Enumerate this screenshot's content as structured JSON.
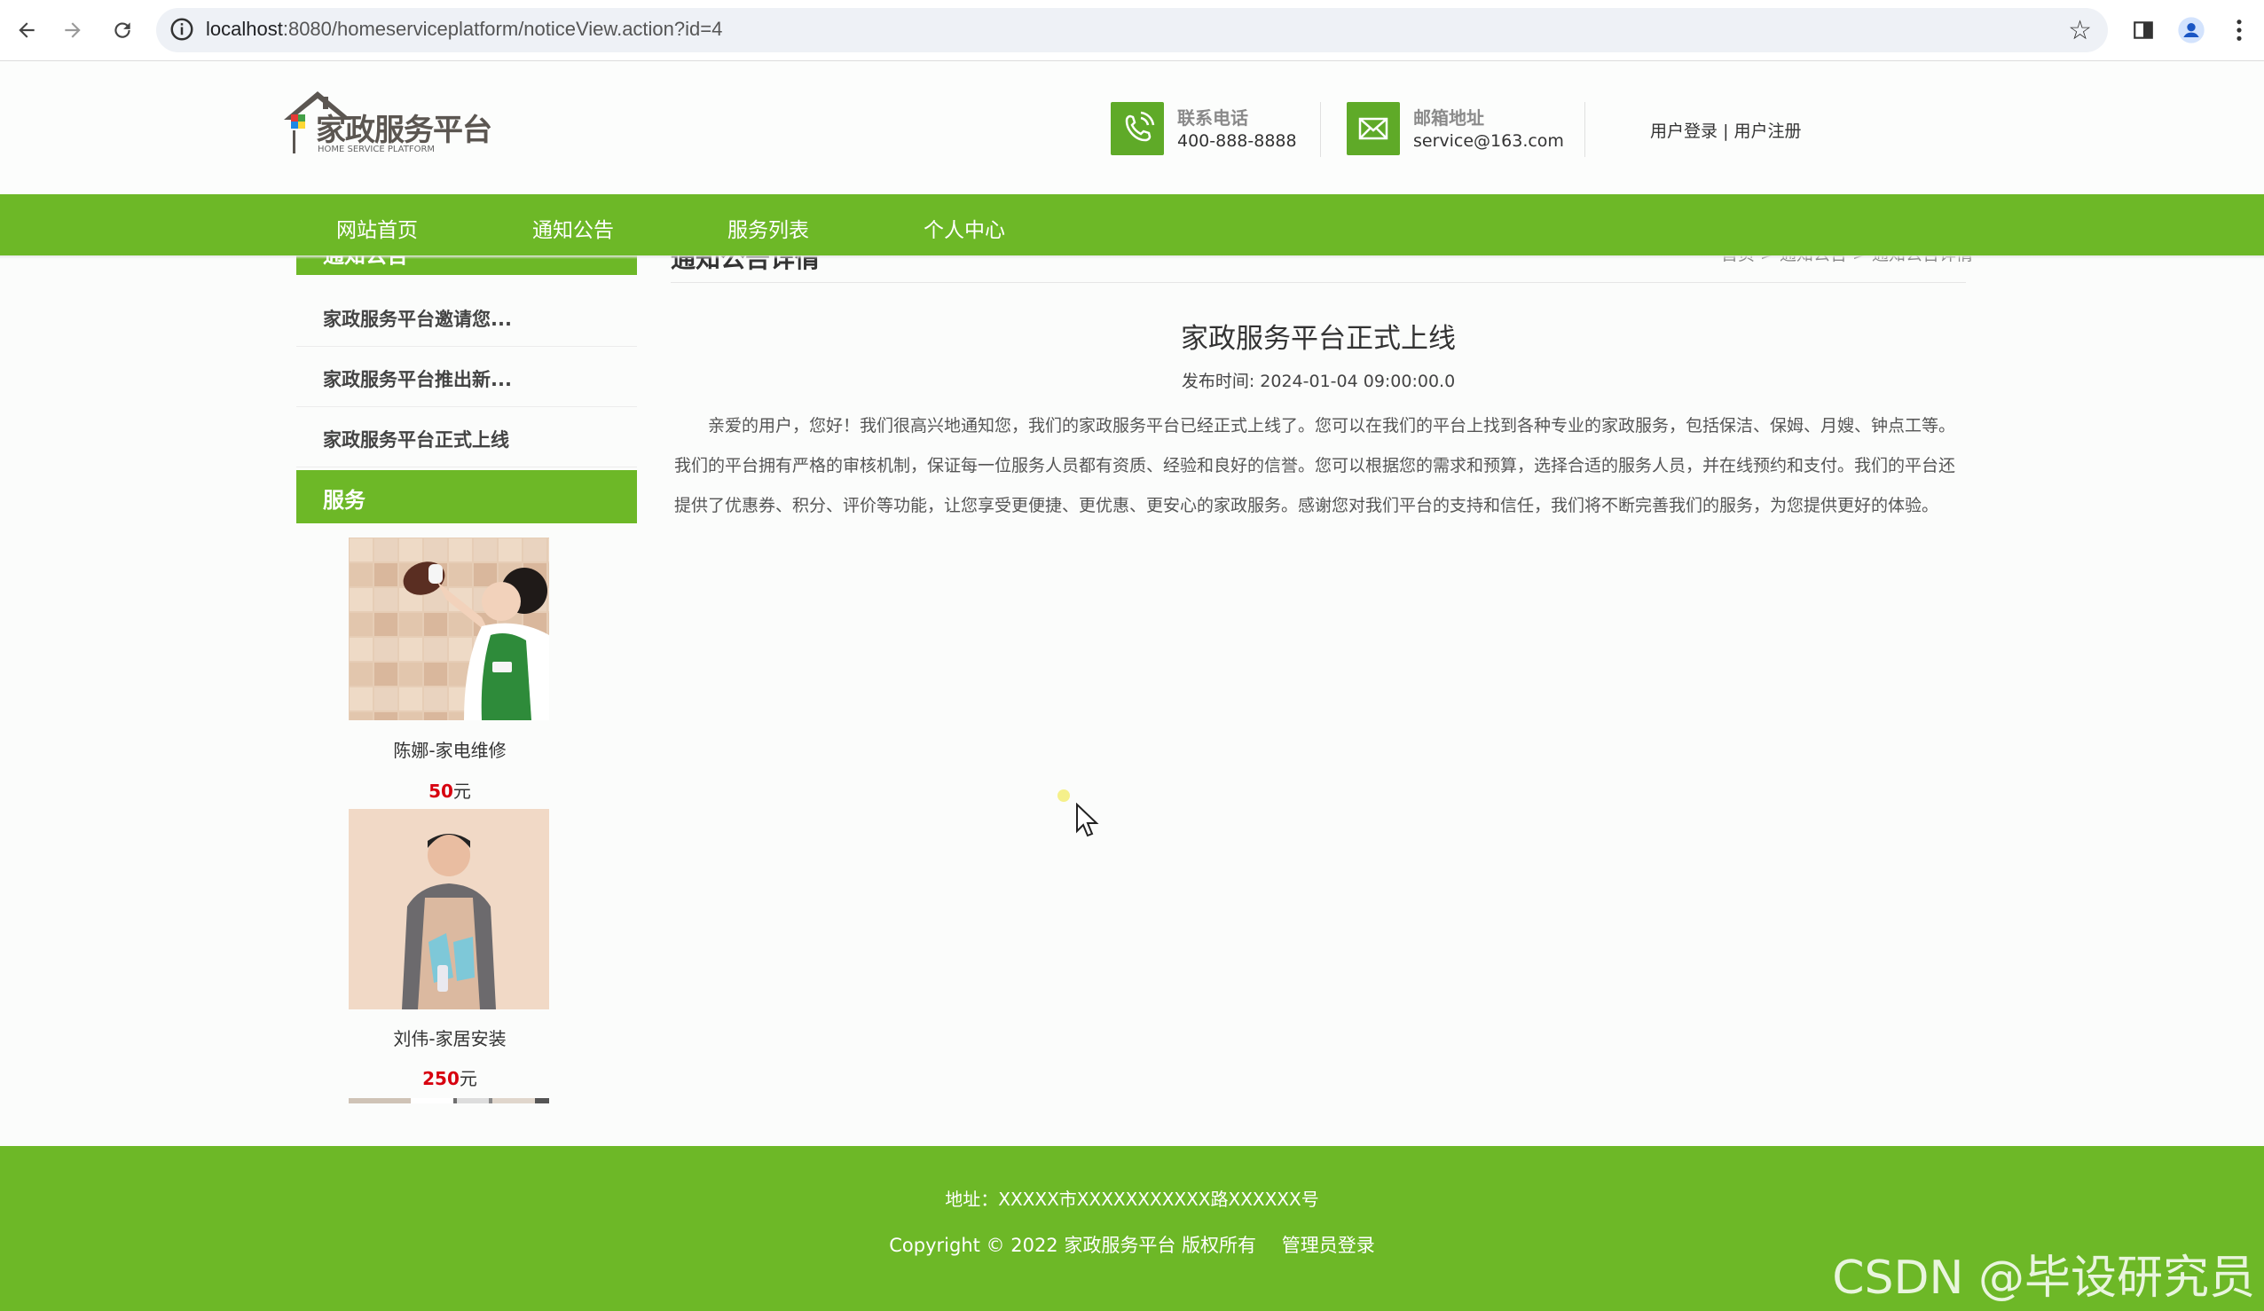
{
  "browser": {
    "url_host": "localhost",
    "url_rest": ":8080/homeserviceplatform/noticeView.action?id=4"
  },
  "header": {
    "logo_cn": "家政服务平台",
    "logo_en": "HOME SERVICE PLATFORM",
    "phone_title": "联系电话",
    "phone_value": "400-888-8888",
    "email_title": "邮箱地址",
    "email_value": "service@163.com",
    "login": "用户登录",
    "separator": "|",
    "register": "用户注册"
  },
  "nav": {
    "items": [
      "网站首页",
      "通知公告",
      "服务列表",
      "个人中心"
    ]
  },
  "sidebar": {
    "notice_heading": "通知公告",
    "notices": [
      "家政服务平台邀请您...",
      "家政服务平台推出新...",
      "家政服务平台正式上线"
    ],
    "service_heading": "服务",
    "services": [
      {
        "name": "陈娜-家电维修",
        "price": "50",
        "unit": "元"
      },
      {
        "name": "刘伟-家居安装",
        "price": "250",
        "unit": "元"
      }
    ]
  },
  "main": {
    "section_title": "通知公告详情",
    "breadcrumb": "首页 > 通知公告 > 通知公告详情",
    "article_title": "家政服务平台正式上线",
    "publish_label": "发布时间:",
    "publish_time": "2024-01-04 09:00:00.0",
    "body": "亲爱的用户，您好！我们很高兴地通知您，我们的家政服务平台已经正式上线了。您可以在我们的平台上找到各种专业的家政服务，包括保洁、保姆、月嫂、钟点工等。我们的平台拥有严格的审核机制，保证每一位服务人员都有资质、经验和良好的信誉。您可以根据您的需求和预算，选择合适的服务人员，并在线预约和支付。我们的平台还提供了优惠券、积分、评价等功能，让您享受更便捷、更优惠、更安心的家政服务。感谢您对我们平台的支持和信任，我们将不断完善我们的服务，为您提供更好的体验。"
  },
  "footer": {
    "address": "地址：XXXXX市XXXXXXXXXXX路XXXXXX号",
    "copyright": "Copyright © 2022 家政服务平台 版权所有",
    "admin_login": "管理员登录"
  },
  "watermark": "CSDN @毕设研究员",
  "colors": {
    "brand_green": "#6db827",
    "price_red": "#d7000f"
  }
}
